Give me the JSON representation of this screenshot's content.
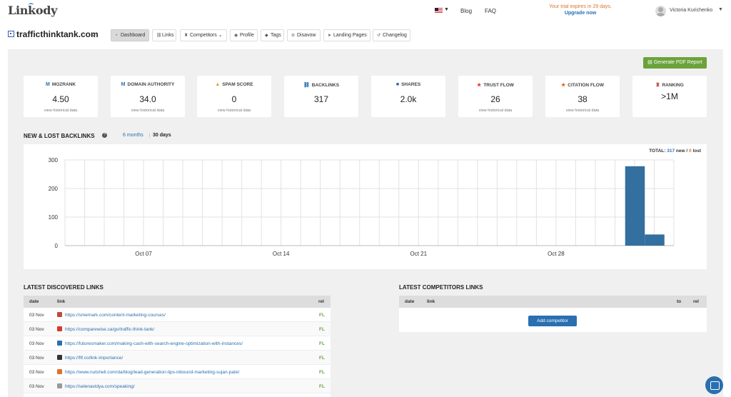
{
  "topbar": {
    "logo": "Linkody",
    "nav": [
      {
        "label": "Blog"
      },
      {
        "label": "FAQ"
      }
    ],
    "trial_text": "Your trial expires in 29 days.",
    "upgrade_label": "Upgrade now",
    "username": "Victoria Kurichenko"
  },
  "domain": {
    "name": "trafficthinktank.com",
    "tabs": [
      {
        "label": "Dashboard",
        "icon": "dashboard-icon"
      },
      {
        "label": "Links",
        "icon": "link-icon"
      },
      {
        "label": "Competitors",
        "icon": "trophy-icon"
      },
      {
        "label": "Profile",
        "icon": "profile-icon"
      },
      {
        "label": "Tags",
        "icon": "tag-icon"
      },
      {
        "label": "Disavow",
        "icon": "block-icon"
      },
      {
        "label": "Landing Pages",
        "icon": "send-icon"
      },
      {
        "label": "Changelog",
        "icon": "history-icon"
      }
    ]
  },
  "pdf_button": "Generate PDF Report",
  "metrics": [
    {
      "title": "MOZRANK",
      "value": "4.50",
      "hist": "view historical data",
      "icon": "moz-icon"
    },
    {
      "title": "DOMAIN AUTHORITY",
      "value": "34.0",
      "hist": "view historical data",
      "icon": "moz-icon"
    },
    {
      "title": "SPAM SCORE",
      "value": "0",
      "hist": "view historical data",
      "icon": "warning-icon"
    },
    {
      "title": "BACKLINKS",
      "value": "317",
      "hist": "",
      "icon": "link-icon"
    },
    {
      "title": "SHARES",
      "value": "2.0k",
      "hist": "",
      "icon": "facebook-icon"
    },
    {
      "title": "TRUST FLOW",
      "value": "26",
      "hist": "view historical data",
      "icon": "star-icon"
    },
    {
      "title": "CITATION FLOW",
      "value": "38",
      "hist": "view historical data",
      "icon": "star-icon"
    },
    {
      "title": "RANKING",
      "value": ">1M",
      "hist": "",
      "icon": "trophy-icon"
    }
  ],
  "backlinks_section": {
    "title": "NEW & LOST BACKLINKS",
    "range_tabs": [
      "6 months",
      "30 days"
    ],
    "total_label": "TOTAL:",
    "total_new": "317",
    "total_new_label": "new /",
    "total_lost": "0",
    "total_lost_label": "lost"
  },
  "chart_data": {
    "type": "bar",
    "y_ticks": [
      0,
      100,
      200,
      300
    ],
    "ylim": [
      0,
      300
    ],
    "x_tick_labels": [
      {
        "label": "Oct 07",
        "day": 7
      },
      {
        "label": "Oct 14",
        "day": 14
      },
      {
        "label": "Oct 21",
        "day": 21
      },
      {
        "label": "Oct 28",
        "day": 28
      }
    ],
    "x_range_days": [
      3,
      34
    ],
    "bars": [
      {
        "day": 32,
        "value": 278
      },
      {
        "day": 33,
        "value": 39
      }
    ],
    "grid": true,
    "bar_color": "#336f9f"
  },
  "discovered": {
    "title": "LATEST DISCOVERED LINKS",
    "headers": {
      "date": "date",
      "link": "link",
      "rel": "rel"
    },
    "rows": [
      {
        "date": "03 Nov",
        "link": "https://smemark.com/content-marketing-courses/",
        "rel": "FL",
        "fav": "#c04a3a"
      },
      {
        "date": "03 Nov",
        "link": "https://comparewise.ca/go/traffic-think-tank/",
        "rel": "FL",
        "fav": "#d63a2a"
      },
      {
        "date": "03 Nov",
        "link": "https://futuresmaker.com/making-cash-with-search-engine-optimization-with-instances/",
        "rel": "FL",
        "fav": "#2a6fb0"
      },
      {
        "date": "03 Nov",
        "link": "https://ftf.co/link-importance/",
        "rel": "FL",
        "fav": "#333333"
      },
      {
        "date": "03 Nov",
        "link": "https://www.nutshell.com/da/blog/lead-generation-tips-inbound-marketing-sujan-patel",
        "rel": "FL",
        "fav": "#e0702a"
      },
      {
        "date": "03 Nov",
        "link": "https://selenavidya.com/speaking/",
        "rel": "FL",
        "fav": "#999999"
      }
    ]
  },
  "competitors": {
    "title": "LATEST COMPETITORS LINKS",
    "headers": {
      "date": "date",
      "link": "link",
      "to": "to",
      "rel": "rel"
    },
    "add_button": "Add competitor"
  }
}
